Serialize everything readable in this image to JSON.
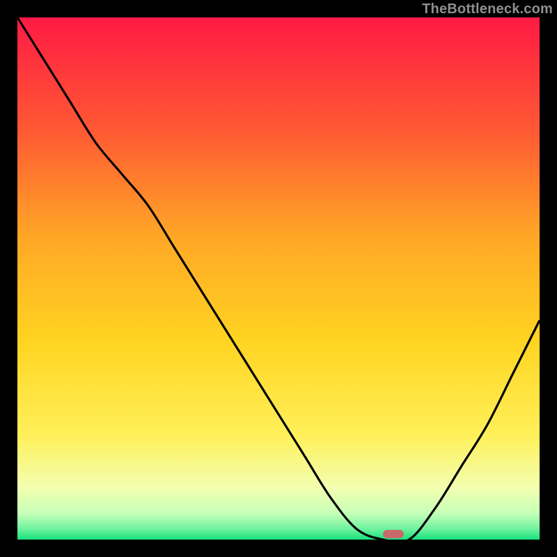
{
  "watermark": "TheBottleneck.com",
  "colors": {
    "frame_bg": "#000000",
    "grad_top": "#ff1a44",
    "grad_upper_mid": "#ff8a2a",
    "grad_mid": "#ffd421",
    "grad_lower": "#fff66a",
    "grad_pale": "#ecffce",
    "grad_bottom": "#18e07c",
    "curve": "#000000",
    "cursor": "#c96a6a",
    "watermark_text": "#8f8f8f"
  },
  "chart_data": {
    "type": "line",
    "title": "",
    "xlabel": "",
    "ylabel": "",
    "xlim": [
      0,
      100
    ],
    "ylim": [
      0,
      100
    ],
    "x": [
      0,
      5,
      10,
      15,
      20,
      25,
      30,
      35,
      40,
      45,
      50,
      55,
      60,
      65,
      70,
      75,
      80,
      85,
      90,
      95,
      100
    ],
    "values": [
      100,
      92,
      84,
      76,
      70,
      64,
      56,
      48,
      40,
      32,
      24,
      16,
      8,
      2,
      0,
      0,
      6,
      14,
      22,
      32,
      42
    ],
    "cursor_x": 72,
    "annotations": []
  }
}
